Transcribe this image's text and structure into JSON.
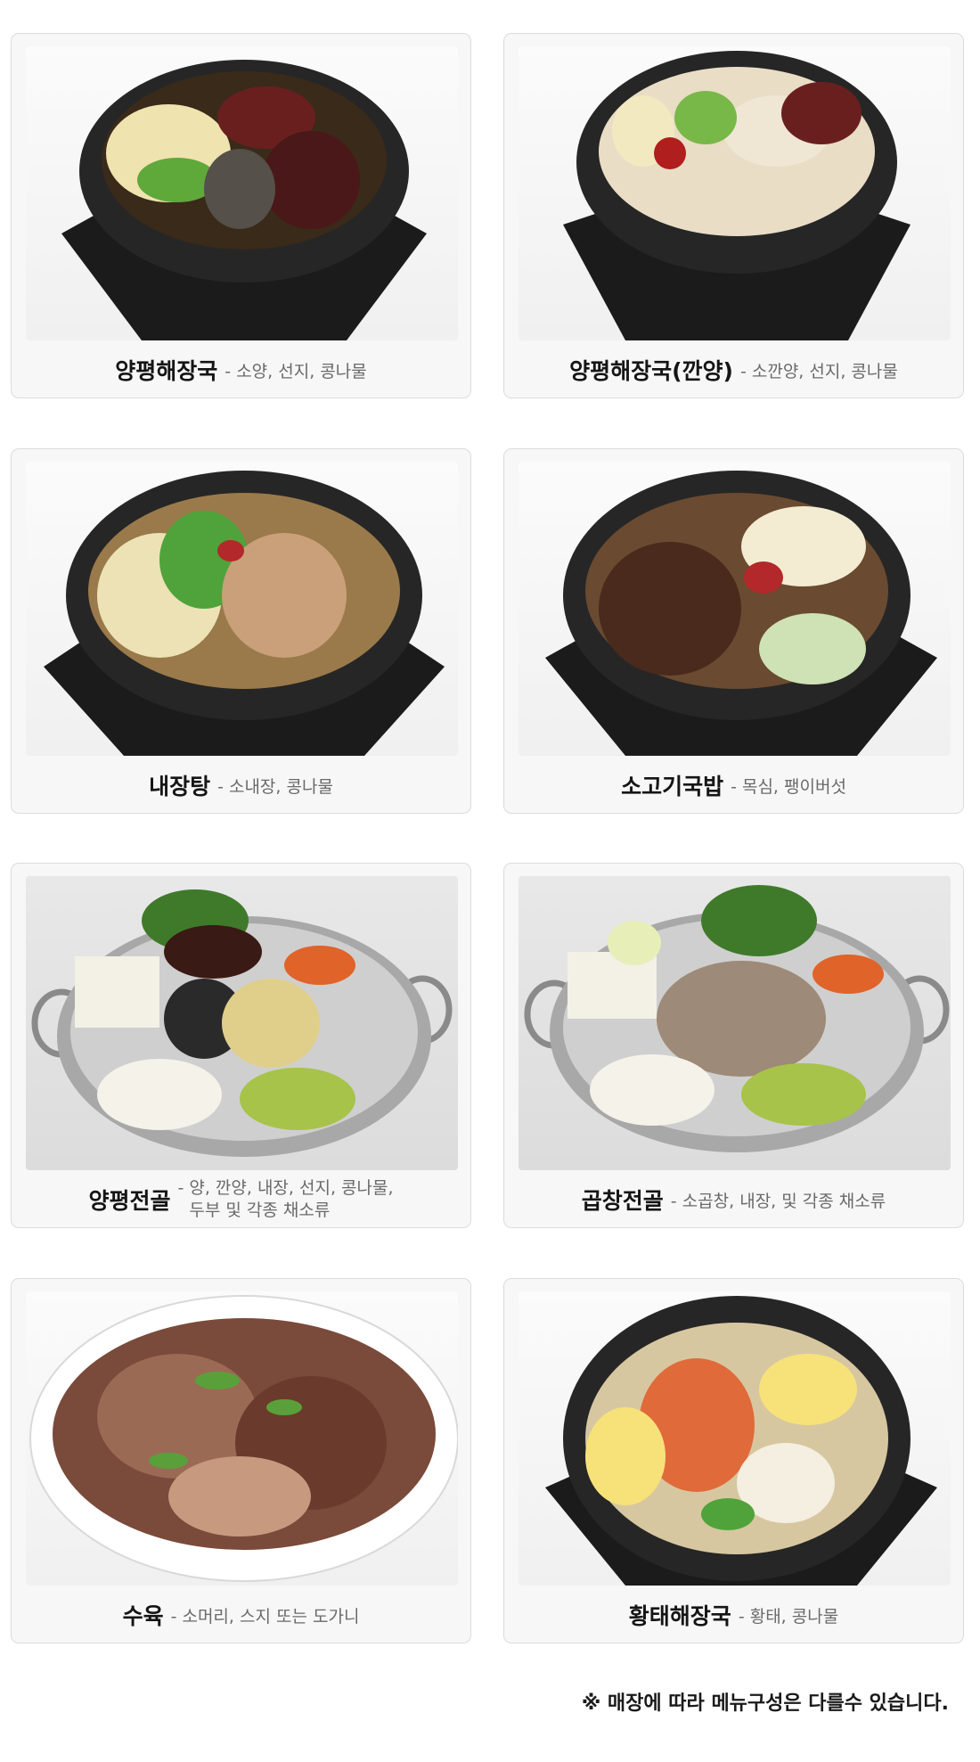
{
  "menu": {
    "items": [
      {
        "name": "양평해장국",
        "description": "- 소양, 선지, 콩나물",
        "image": "pot-dish-photo"
      },
      {
        "name": "양평해장국(깐양)",
        "description": "- 소깐양, 선지, 콩나물",
        "image": "pot-dish-photo"
      },
      {
        "name": "내장탕",
        "description": "- 소내장, 콩나물",
        "image": "pot-dish-photo"
      },
      {
        "name": "소고기국밥",
        "description": "- 목심, 팽이버섯",
        "image": "pot-dish-photo"
      },
      {
        "name": "양평전골",
        "description_lines": [
          "양, 깐양, 내장, 선지, 콩나물,",
          "두부 및 각종 채소류"
        ],
        "dash": "-",
        "image": "hotpot-photo"
      },
      {
        "name": "곱창전골",
        "description": "- 소곱창, 내장, 및 각종 채소류",
        "image": "hotpot-photo"
      },
      {
        "name": "수육",
        "description": "- 소머리, 스지 또는 도가니",
        "image": "plate-photo"
      },
      {
        "name": "황태해장국",
        "description": "- 황태, 콩나물",
        "image": "pot-dish-photo"
      }
    ]
  },
  "footnote": "※ 매장에 따라 메뉴구성은 다를수 있습니다."
}
